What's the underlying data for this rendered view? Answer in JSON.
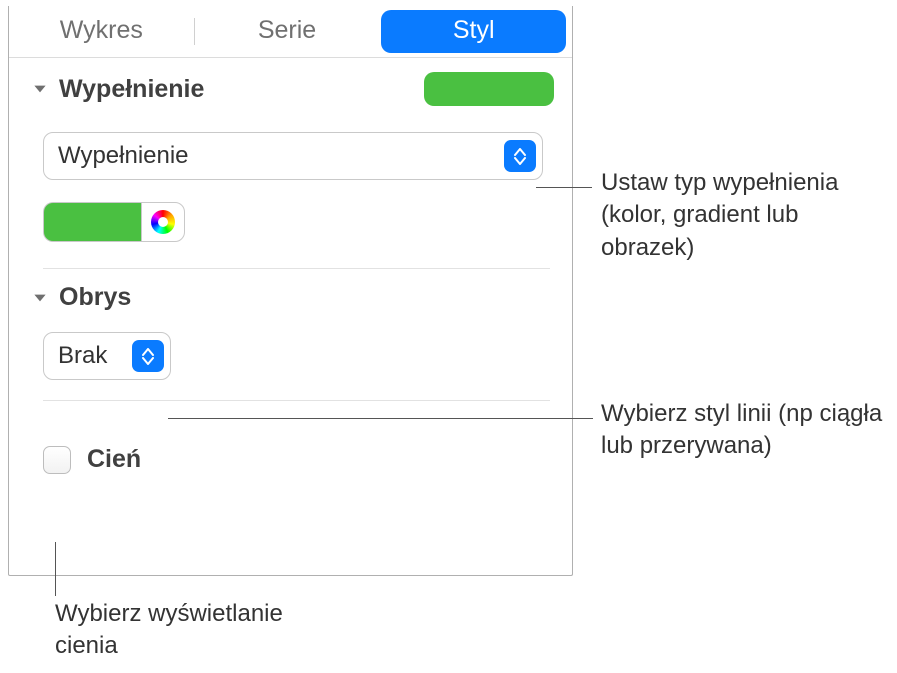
{
  "tabs": {
    "chart": "Wykres",
    "series": "Serie",
    "style": "Styl"
  },
  "fill": {
    "title": "Wypełnienie",
    "type_label": "Wypełnienie",
    "preview_color": "#4ac041"
  },
  "stroke": {
    "title": "Obrys",
    "style_label": "Brak"
  },
  "shadow": {
    "title": "Cień"
  },
  "callouts": {
    "fill": "Ustaw typ wypełnienia (kolor, gradient lub obrazek)",
    "stroke": "Wybierz styl linii (np ciągła lub przerywana)",
    "shadow": "Wybierz wyświetlanie cienia"
  }
}
